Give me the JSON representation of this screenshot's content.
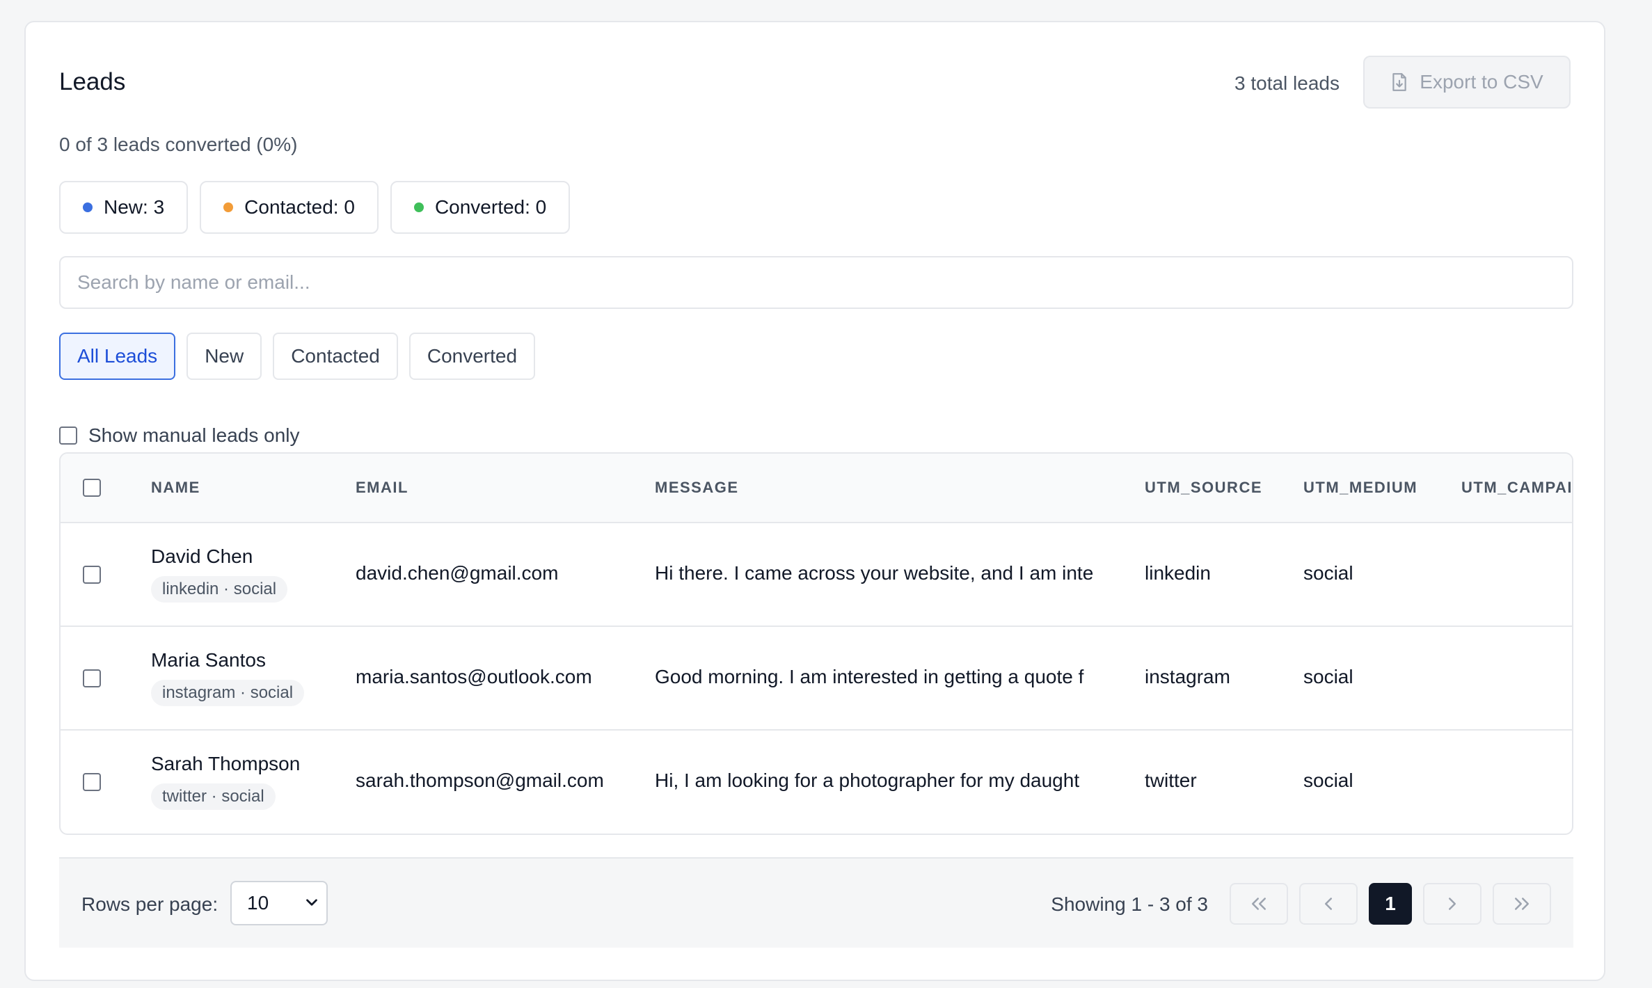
{
  "header": {
    "title": "Leads",
    "total": "3 total leads",
    "export_label": "Export to CSV"
  },
  "summary": "0 of 3 leads converted (0%)",
  "status_pills": [
    {
      "label": "New: 3",
      "color": "#3b6fe0"
    },
    {
      "label": "Contacted: 0",
      "color": "#f29c38"
    },
    {
      "label": "Converted: 0",
      "color": "#3fbf5a"
    }
  ],
  "search": {
    "placeholder": "Search by name or email..."
  },
  "filters": [
    "All Leads",
    "New",
    "Contacted",
    "Converted"
  ],
  "active_filter": "All Leads",
  "manual_label": "Show manual leads only",
  "table": {
    "columns": [
      "NAME",
      "EMAIL",
      "MESSAGE",
      "UTM_SOURCE",
      "UTM_MEDIUM",
      "UTM_CAMPAIC"
    ],
    "rows": [
      {
        "name": "David Chen",
        "tag": "linkedin · social",
        "email": "david.chen@gmail.com",
        "message": "Hi there. I came across your website, and I am inte",
        "utm_source": "linkedin",
        "utm_medium": "social"
      },
      {
        "name": "Maria Santos",
        "tag": "instagram · social",
        "email": "maria.santos@outlook.com",
        "message": "Good morning. I am interested in getting a quote f",
        "utm_source": "instagram",
        "utm_medium": "social"
      },
      {
        "name": "Sarah Thompson",
        "tag": "twitter · social",
        "email": "sarah.thompson@gmail.com",
        "message": "Hi, I am looking for a photographer for my daught",
        "utm_source": "twitter",
        "utm_medium": "social"
      }
    ]
  },
  "footer": {
    "rows_per_page_label": "Rows per page:",
    "rows_per_page_value": "10",
    "showing": "Showing 1 - 3 of 3",
    "current_page": "1"
  }
}
